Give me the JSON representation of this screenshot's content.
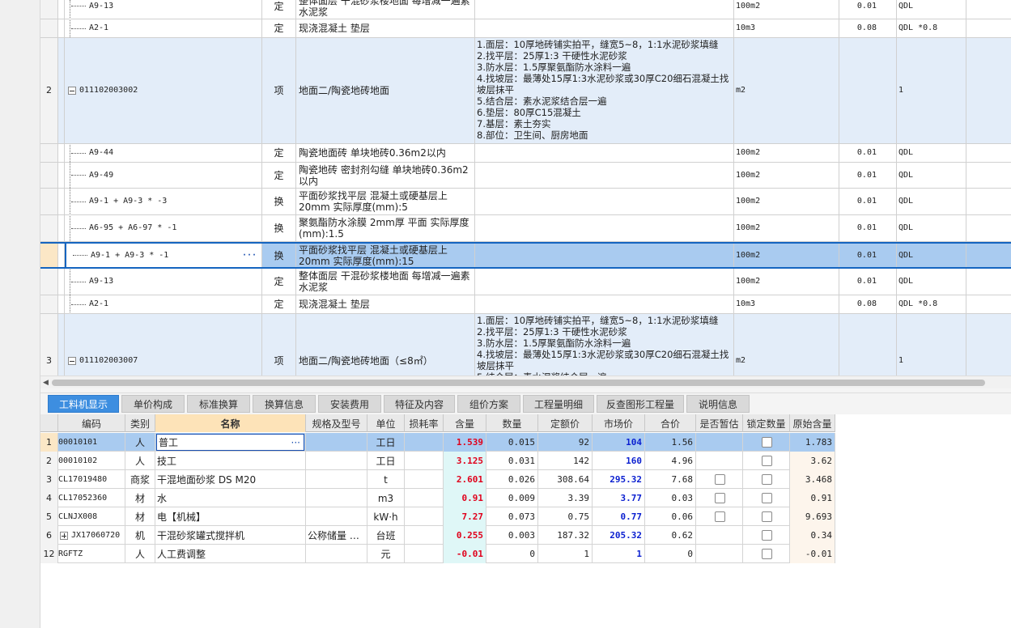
{
  "top_rows": [
    {
      "no": "",
      "code": "A9-13",
      "type": "定",
      "name": "整体面层 干混砂浆楼地面 每增减一遍素水泥浆",
      "features": "",
      "unit": "100m2",
      "qty": "0.01",
      "expr": "QDL"
    },
    {
      "no": "",
      "code": "A2-1",
      "type": "定",
      "name": "现浇混凝土 垫层",
      "features": "",
      "unit": "10m3",
      "qty": "0.08",
      "expr": "QDL *0.8"
    },
    {
      "no": "2",
      "code": "011102003002",
      "type": "项",
      "name": "地面二/陶瓷地砖地面",
      "features": "1.面层：10厚地砖铺实拍平，缝宽5~8，1:1水泥砂浆填缝\n2.找平层：25厚1:3 干硬性水泥砂浆\n3.防水层：1.5厚聚氨酯防水涂料一遍\n4.找坡层：最薄处15厚1:3水泥砂浆或30厚C20细石混凝土找坡层抹平\n5.结合层：素水泥浆结合层一遍\n6.垫层：80厚C15混凝土\n7.基层：素土夯实\n8.部位：卫生间、厨房地面",
      "unit": "m2",
      "qty": "",
      "expr": "1"
    },
    {
      "no": "",
      "code": "A9-44",
      "type": "定",
      "name": "陶瓷地面砖 单块地砖0.36m2以内",
      "features": "",
      "unit": "100m2",
      "qty": "0.01",
      "expr": "QDL"
    },
    {
      "no": "",
      "code": "A9-49",
      "type": "定",
      "name": "陶瓷地砖 密封剂勾缝 单块地砖0.36m2以内",
      "features": "",
      "unit": "100m2",
      "qty": "0.01",
      "expr": "QDL"
    },
    {
      "no": "",
      "code": "A9-1 + A9-3 * -3",
      "type": "换",
      "name": "平面砂浆找平层 混凝土或硬基层上20mm  实际厚度(mm):5",
      "features": "",
      "unit": "100m2",
      "qty": "0.01",
      "expr": "QDL"
    },
    {
      "no": "",
      "code": "A6-95 + A6-97 * -1",
      "type": "换",
      "name": "聚氨酯防水涂膜 2mm厚 平面  实际厚度(mm):1.5",
      "features": "",
      "unit": "100m2",
      "qty": "0.01",
      "expr": "QDL"
    },
    {
      "no": "",
      "code": "A9-1 + A9-3 * -1",
      "type": "换",
      "name": "平面砂浆找平层 混凝土或硬基层上20mm  实际厚度(mm):15",
      "features": "",
      "unit": "100m2",
      "qty": "0.01",
      "expr": "QDL"
    },
    {
      "no": "",
      "code": "A9-13",
      "type": "定",
      "name": "整体面层 干混砂浆楼地面 每增减一遍素水泥浆",
      "features": "",
      "unit": "100m2",
      "qty": "0.01",
      "expr": "QDL"
    },
    {
      "no": "",
      "code": "A2-1",
      "type": "定",
      "name": "现浇混凝土 垫层",
      "features": "",
      "unit": "10m3",
      "qty": "0.08",
      "expr": "QDL *0.8"
    },
    {
      "no": "3",
      "code": "011102003007",
      "type": "项",
      "name": "地面二/陶瓷地砖地面（≤8㎡）",
      "features": "1.面层：10厚地砖铺实拍平，缝宽5~8，1:1水泥砂浆填缝\n2.找平层：25厚1:3 干硬性水泥砂浆\n3.防水层：1.5厚聚氨酯防水涂料一遍\n4.找坡层：最薄处15厚1:3水泥砂浆或30厚C20细石混凝土找坡层抹平\n5.结合层：素水泥浆结合层一遍",
      "unit": "m2",
      "qty": "",
      "expr": "1"
    }
  ],
  "tabs": [
    "工料机显示",
    "单价构成",
    "标准换算",
    "换算信息",
    "安装费用",
    "特征及内容",
    "组价方案",
    "工程量明细",
    "反查图形工程量",
    "说明信息"
  ],
  "columns": [
    "编码",
    "类别",
    "名称",
    "规格及型号",
    "单位",
    "损耗率",
    "含量",
    "数量",
    "定额价",
    "市场价",
    "合价",
    "是否暂估",
    "锁定数量",
    "原始含量"
  ],
  "materials": [
    {
      "no": "1",
      "code": "00010101",
      "cat": "人",
      "name": "普工",
      "spec": "",
      "unit": "工日",
      "loss": "",
      "content": "1.539",
      "qty": "0.015",
      "quota": "92",
      "market": "104",
      "total": "1.56",
      "est": false,
      "lock": true,
      "orig": "1.783"
    },
    {
      "no": "2",
      "code": "00010102",
      "cat": "人",
      "name": "技工",
      "spec": "",
      "unit": "工日",
      "loss": "",
      "content": "3.125",
      "qty": "0.031",
      "quota": "142",
      "market": "160",
      "total": "4.96",
      "est": false,
      "lock": true,
      "orig": "3.62"
    },
    {
      "no": "3",
      "code": "CL17019480",
      "cat": "商浆",
      "name": "干混地面砂浆 DS M20",
      "spec": "",
      "unit": "t",
      "loss": "",
      "content": "2.601",
      "qty": "0.026",
      "quota": "308.64",
      "market": "295.32",
      "total": "7.68",
      "est": true,
      "lock": true,
      "orig": "3.468"
    },
    {
      "no": "4",
      "code": "CL17052360",
      "cat": "材",
      "name": "水",
      "spec": "",
      "unit": "m3",
      "loss": "",
      "content": "0.91",
      "qty": "0.009",
      "quota": "3.39",
      "market": "3.77",
      "total": "0.03",
      "est": true,
      "lock": true,
      "orig": "0.91"
    },
    {
      "no": "5",
      "code": "CLNJX008",
      "cat": "材",
      "name": "电【机械】",
      "spec": "",
      "unit": "kW·h",
      "loss": "",
      "content": "7.27",
      "qty": "0.073",
      "quota": "0.75",
      "market": "0.77",
      "total": "0.06",
      "est": true,
      "lock": true,
      "orig": "9.693"
    },
    {
      "no": "6",
      "code": "JX17060720",
      "cat": "机",
      "name": "干混砂浆罐式搅拌机",
      "spec": "公称储量 …",
      "unit": "台班",
      "loss": "",
      "content": "0.255",
      "qty": "0.003",
      "quota": "187.32",
      "market": "205.32",
      "total": "0.62",
      "est": false,
      "lock": true,
      "orig": "0.34"
    },
    {
      "no": "12",
      "code": "RGFTZ",
      "cat": "人",
      "name": "人工费调整",
      "spec": "",
      "unit": "元",
      "loss": "",
      "content": "-0.01",
      "qty": "0",
      "quota": "1",
      "market": "1",
      "total": "0",
      "est": false,
      "lock": true,
      "orig": "-0.01"
    }
  ]
}
